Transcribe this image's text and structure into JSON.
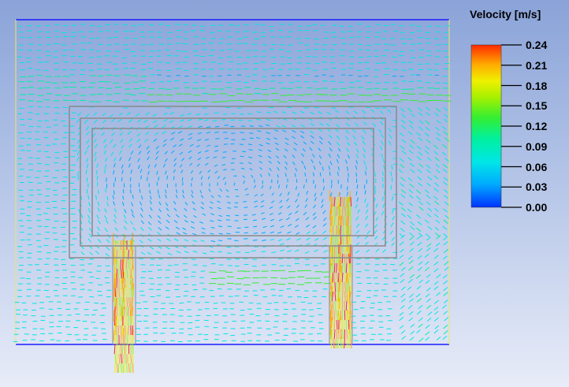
{
  "legend": {
    "title": "Velocity [m/s]",
    "ticks": [
      "0.24",
      "0.21",
      "0.18",
      "0.15",
      "0.12",
      "0.09",
      "0.06",
      "0.03",
      "0.00"
    ],
    "colormap": [
      "#0033ff",
      "#00aaff",
      "#00e6e6",
      "#00f0a0",
      "#33ee33",
      "#a8f000",
      "#f0f000",
      "#ffaa00",
      "#ff2a00"
    ]
  },
  "colors": {
    "domain_boundary": "#1a1aff",
    "wall_outline": "#888888",
    "background_top": "#8aa3d8",
    "background_bottom": "#e8ecf8"
  }
}
